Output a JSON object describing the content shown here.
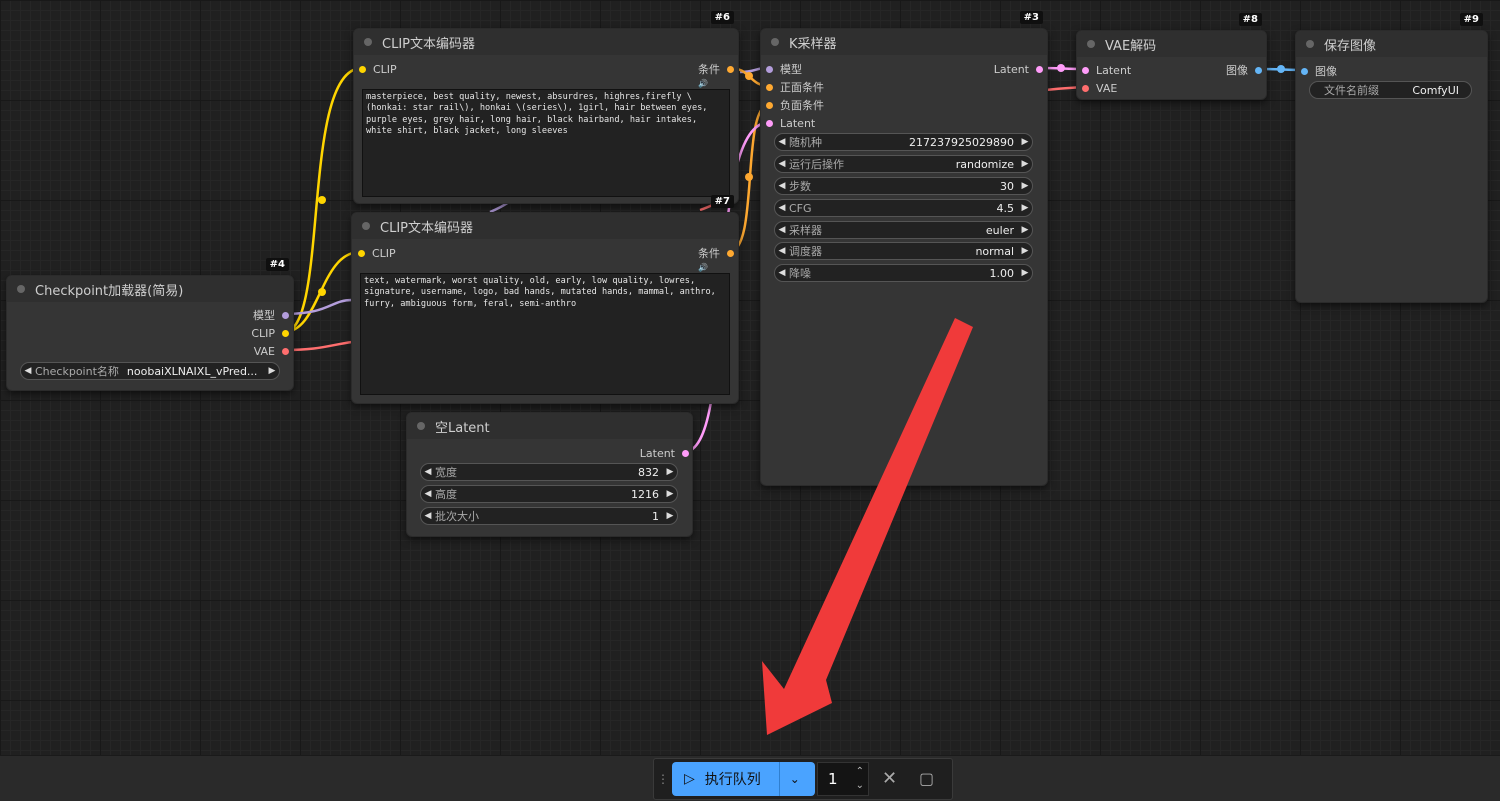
{
  "nodes": {
    "clip_pos": {
      "id": "#6",
      "title": "CLIP文本编码器",
      "input": "CLIP",
      "output": "条件",
      "text": "masterpiece, best quality, newest, absurdres, highres,firefly \\(honkai: star rail\\), honkai \\(series\\), 1girl, hair between eyes, purple eyes, grey hair, long hair, black hairband, hair intakes, white shirt, black jacket, long sleeves"
    },
    "clip_neg": {
      "id": "#7",
      "title": "CLIP文本编码器",
      "input": "CLIP",
      "output": "条件",
      "text": "text, watermark, worst quality, old, early, low quality, lowres, signature, username, logo, bad hands, mutated hands, mammal, anthro, furry, ambiguous form, feral, semi-anthro"
    },
    "checkpoint": {
      "id": "#4",
      "title": "Checkpoint加载器(简易)",
      "outputs": [
        "模型",
        "CLIP",
        "VAE"
      ],
      "widget_label": "Checkpoint名称",
      "widget_value": "noobaiXLNAIXL_vPred..."
    },
    "empty_latent": {
      "id": "#5",
      "title": "空Latent",
      "output": "Latent",
      "widgets": [
        {
          "label": "宽度",
          "value": "832"
        },
        {
          "label": "高度",
          "value": "1216"
        },
        {
          "label": "批次大小",
          "value": "1"
        }
      ]
    },
    "ksampler": {
      "id": "#3",
      "title": "K采样器",
      "output": "Latent",
      "inputs": [
        "模型",
        "正面条件",
        "负面条件",
        "Latent"
      ],
      "widgets": [
        {
          "label": "随机种",
          "value": "217237925029890"
        },
        {
          "label": "运行后操作",
          "value": "randomize"
        },
        {
          "label": "步数",
          "value": "30"
        },
        {
          "label": "CFG",
          "value": "4.5"
        },
        {
          "label": "采样器",
          "value": "euler"
        },
        {
          "label": "调度器",
          "value": "normal"
        },
        {
          "label": "降噪",
          "value": "1.00"
        }
      ]
    },
    "vae_decode": {
      "id": "#8",
      "title": "VAE解码",
      "inputs": [
        "Latent",
        "VAE"
      ],
      "output": "图像"
    },
    "save_image": {
      "id": "#9",
      "title": "保存图像",
      "input": "图像",
      "widget_label": "文件名前缀",
      "widget_value": "ComfyUI"
    }
  },
  "toolbar": {
    "run_label": "执行队列",
    "count": "1"
  },
  "colors": {
    "model": "#b39ddb",
    "clip": "#ffd500",
    "vae": "#ff6e6e",
    "conditioning": "#ffa931",
    "latent": "#ff9cf9",
    "image": "#64b5f6",
    "run_button": "#4aa3ff",
    "annotation_arrow": "#f03a3a"
  }
}
